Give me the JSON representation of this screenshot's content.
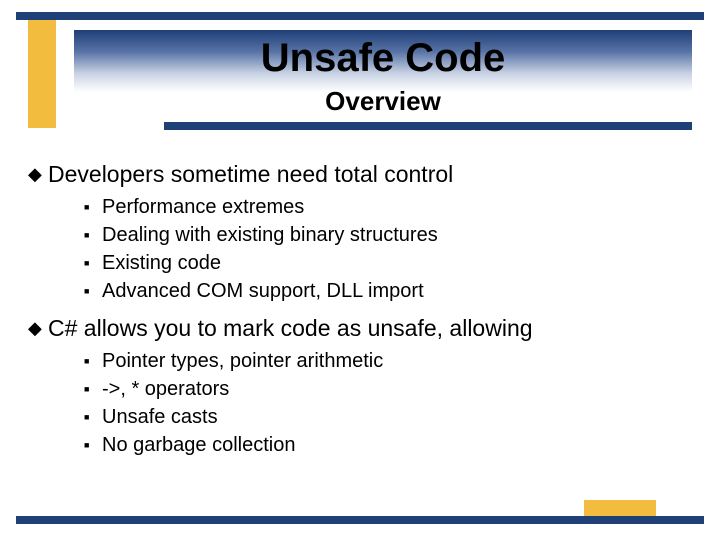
{
  "title": "Unsafe Code",
  "subtitle": "Overview",
  "points": [
    {
      "text": "Developers sometime need total control",
      "sub": [
        "Performance extremes",
        "Dealing with existing binary structures",
        "Existing code",
        "Advanced COM support, DLL import"
      ]
    },
    {
      "text": "C# allows you to mark code as unsafe, allowing",
      "sub": [
        "Pointer types, pointer arithmetic",
        "->, * operators",
        "Unsafe casts",
        "No garbage collection"
      ]
    }
  ],
  "colors": {
    "navy": "#1f3f77",
    "gold": "#f2bd3e"
  }
}
